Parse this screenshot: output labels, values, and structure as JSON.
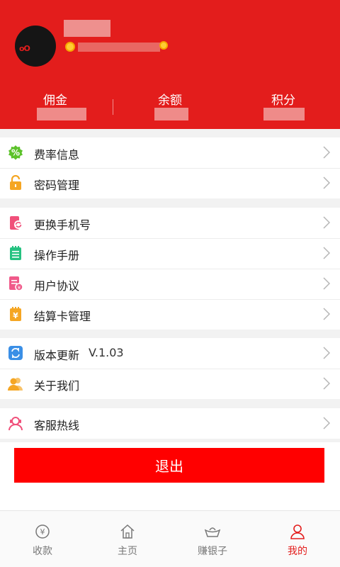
{
  "profile": {
    "avatar_text": "oO"
  },
  "stats": [
    {
      "label": "佣金"
    },
    {
      "label": "余额"
    },
    {
      "label": "积分"
    }
  ],
  "menu": {
    "group1": [
      {
        "label": "费率信息",
        "icon": "percent-icon"
      },
      {
        "label": "密码管理",
        "icon": "lock-icon"
      }
    ],
    "group2": [
      {
        "label": "更换手机号",
        "icon": "phone-change-icon"
      },
      {
        "label": "操作手册",
        "icon": "manual-icon"
      },
      {
        "label": "用户协议",
        "icon": "agreement-icon"
      },
      {
        "label": "结算卡管理",
        "icon": "settlement-card-icon"
      }
    ],
    "group3": [
      {
        "label": "版本更新",
        "icon": "refresh-icon",
        "version": "V.1.03"
      },
      {
        "label": "关于我们",
        "icon": "people-icon"
      }
    ],
    "group4": [
      {
        "label": "客服热线",
        "icon": "customer-service-icon"
      }
    ]
  },
  "logout_label": "退出",
  "tabs": [
    {
      "label": "收款",
      "icon": "yen-coin-icon",
      "active": false
    },
    {
      "label": "主页",
      "icon": "home-icon",
      "active": false
    },
    {
      "label": "赚银子",
      "icon": "silver-ingot-icon",
      "active": false
    },
    {
      "label": "我的",
      "icon": "user-icon",
      "active": true
    }
  ],
  "colors": {
    "brand_red": "#e31d1c",
    "logout_red": "#ff0000",
    "tab_active": "#e31d1c",
    "tab_inactive": "#777777"
  }
}
